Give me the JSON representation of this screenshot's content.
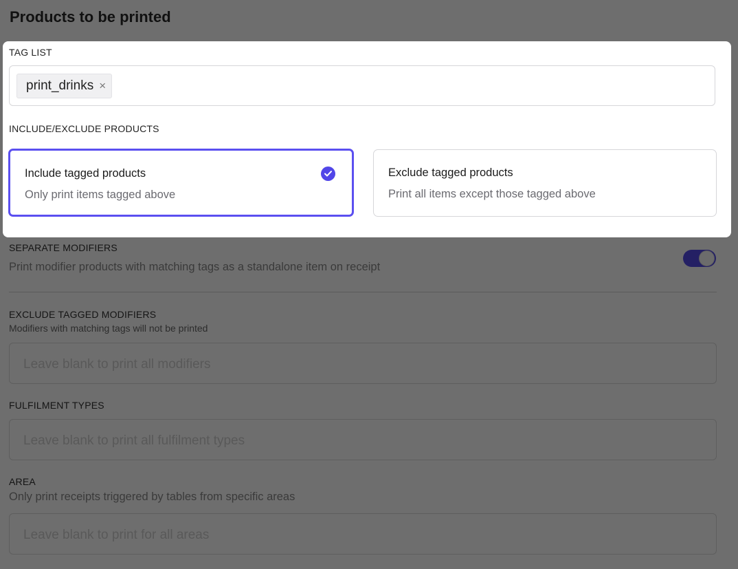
{
  "page": {
    "title": "Products to be printed"
  },
  "tag_list": {
    "label": "TAG LIST",
    "tags": [
      {
        "text": "print_drinks",
        "remove_glyph": "×"
      }
    ]
  },
  "include_exclude": {
    "label": "INCLUDE/EXCLUDE PRODUCTS",
    "options": [
      {
        "title": "Include tagged products",
        "subtitle": "Only print items tagged above",
        "selected": true
      },
      {
        "title": "Exclude tagged products",
        "subtitle": "Print all items except those tagged above",
        "selected": false
      }
    ]
  },
  "separate_modifiers": {
    "label": "SEPARATE MODIFIERS",
    "description": "Print modifier products with matching tags as a standalone item on receipt",
    "enabled": true
  },
  "exclude_tagged_modifiers": {
    "label": "EXCLUDE TAGGED MODIFIERS",
    "description": "Modifiers with matching tags will not be printed",
    "placeholder": "Leave blank to print all modifiers"
  },
  "fulfilment_types": {
    "label": "FULFILMENT TYPES",
    "placeholder": "Leave blank to print all fulfilment types"
  },
  "area": {
    "label": "AREA",
    "description": "Only print receipts triggered by tables from specific areas",
    "placeholder": "Leave blank to print for all areas"
  },
  "colors": {
    "accent": "#5146e8",
    "overlay": "#6e6e6e",
    "toggle_on": "#242064"
  },
  "icons": {
    "selected": "check-circle-icon",
    "remove_tag": "close-icon"
  }
}
